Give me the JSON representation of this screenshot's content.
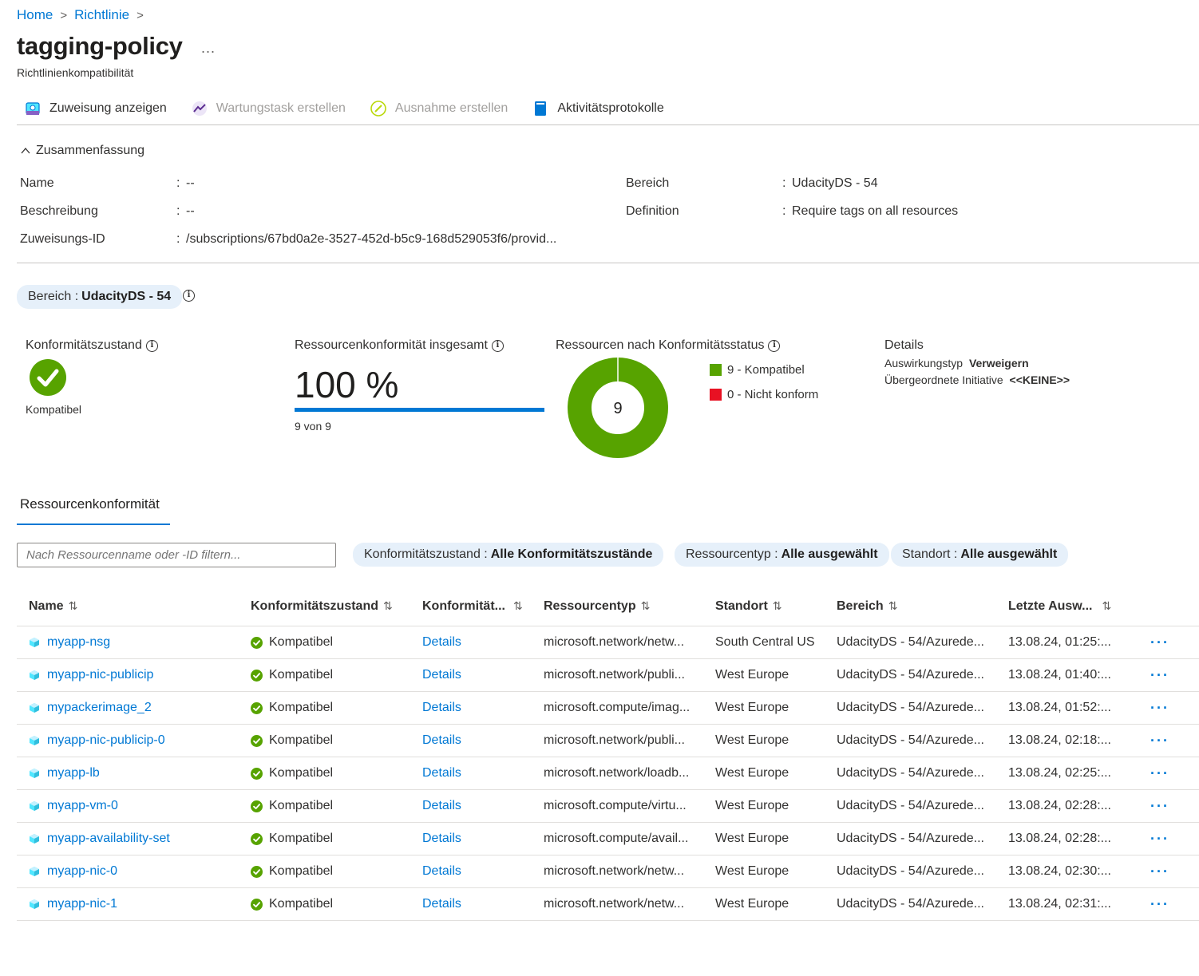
{
  "breadcrumb": {
    "home": "Home",
    "richtlinie": "Richtlinie"
  },
  "page": {
    "title": "tagging-policy",
    "more": "...",
    "subtitle": "Richtlinienkompatibilität"
  },
  "toolbar": {
    "view_assignment": "Zuweisung anzeigen",
    "create_remediation": "Wartungstask erstellen",
    "create_exemption": "Ausnahme erstellen",
    "activity_log": "Aktivitätsprotokolle"
  },
  "summary": {
    "toggle": "Zusammenfassung",
    "name_label": "Name",
    "name_value": "--",
    "desc_label": "Beschreibung",
    "desc_value": "--",
    "id_label": "Zuweisungs-ID",
    "id_value": "/subscriptions/67bd0a2e-3527-452d-b5c9-168d529053f6/provid...",
    "scope_label": "Bereich",
    "scope_value": "UdacityDS - 54",
    "def_label": "Definition",
    "def_value": "Require tags on all resources",
    "colon": ":"
  },
  "scope_pill": {
    "label": "Bereich :",
    "value": "UdacityDS - 54"
  },
  "stats": {
    "state_label": "Konformitätszustand",
    "state_value": "Kompatibel",
    "overall_label": "Ressourcenkonformität insgesamt",
    "overall_pct": "100 %",
    "overall_percent": 100,
    "overall_sub": "9 von 9",
    "bystatus_label": "Ressourcen nach Konformitätsstatus",
    "donut_center": "9",
    "compliant_count": 9,
    "noncompliant_count": 0,
    "legend_compliant": "9 - Kompatibel",
    "legend_noncompliant": "0 - Nicht konform",
    "colors": {
      "compliant": "#57a300",
      "noncompliant": "#e81123"
    }
  },
  "details": {
    "title": "Details",
    "effect_label": "Auswirkungstyp",
    "effect_value": "Verweigern",
    "initiative_label": "Übergeordnete Initiative",
    "initiative_value": "<<KEINE>>"
  },
  "tab": {
    "label": "Ressourcenkonformität"
  },
  "filters": {
    "search_placeholder": "Nach Ressourcenname oder -ID filtern...",
    "state_label": "Konformitätszustand :",
    "state_value": "Alle Konformitätszustände",
    "type_label": "Ressourcentyp :",
    "type_value": "Alle ausgewählt",
    "loc_label": "Standort :",
    "loc_value": "Alle ausgewählt"
  },
  "table": {
    "headers": [
      "Name",
      "Konformitätszustand",
      "Konformität...",
      "Ressourcentyp",
      "Standort",
      "Bereich",
      "Letzte Ausw..."
    ],
    "rows": [
      {
        "name": "myapp-nsg",
        "state": "Kompatibel",
        "details": "Details",
        "type": "microsoft.network/netw...",
        "location": "South Central US",
        "scope": "UdacityDS - 54/Azurede...",
        "last": "13.08.24, 01:25:..."
      },
      {
        "name": "myapp-nic-publicip",
        "state": "Kompatibel",
        "details": "Details",
        "type": "microsoft.network/publi...",
        "location": "West Europe",
        "scope": "UdacityDS - 54/Azurede...",
        "last": "13.08.24, 01:40:..."
      },
      {
        "name": "mypackerimage_2",
        "state": "Kompatibel",
        "details": "Details",
        "type": "microsoft.compute/imag...",
        "location": "West Europe",
        "scope": "UdacityDS - 54/Azurede...",
        "last": "13.08.24, 01:52:..."
      },
      {
        "name": "myapp-nic-publicip-0",
        "state": "Kompatibel",
        "details": "Details",
        "type": "microsoft.network/publi...",
        "location": "West Europe",
        "scope": "UdacityDS - 54/Azurede...",
        "last": "13.08.24, 02:18:..."
      },
      {
        "name": "myapp-lb",
        "state": "Kompatibel",
        "details": "Details",
        "type": "microsoft.network/loadb...",
        "location": "West Europe",
        "scope": "UdacityDS - 54/Azurede...",
        "last": "13.08.24, 02:25:..."
      },
      {
        "name": "myapp-vm-0",
        "state": "Kompatibel",
        "details": "Details",
        "type": "microsoft.compute/virtu...",
        "location": "West Europe",
        "scope": "UdacityDS - 54/Azurede...",
        "last": "13.08.24, 02:28:..."
      },
      {
        "name": "myapp-availability-set",
        "state": "Kompatibel",
        "details": "Details",
        "type": "microsoft.compute/avail...",
        "location": "West Europe",
        "scope": "UdacityDS - 54/Azurede...",
        "last": "13.08.24, 02:28:..."
      },
      {
        "name": "myapp-nic-0",
        "state": "Kompatibel",
        "details": "Details",
        "type": "microsoft.network/netw...",
        "location": "West Europe",
        "scope": "UdacityDS - 54/Azurede...",
        "last": "13.08.24, 02:30:..."
      },
      {
        "name": "myapp-nic-1",
        "state": "Kompatibel",
        "details": "Details",
        "type": "microsoft.network/netw...",
        "location": "West Europe",
        "scope": "UdacityDS - 54/Azurede...",
        "last": "13.08.24, 02:31:..."
      }
    ],
    "row_more": "···"
  }
}
